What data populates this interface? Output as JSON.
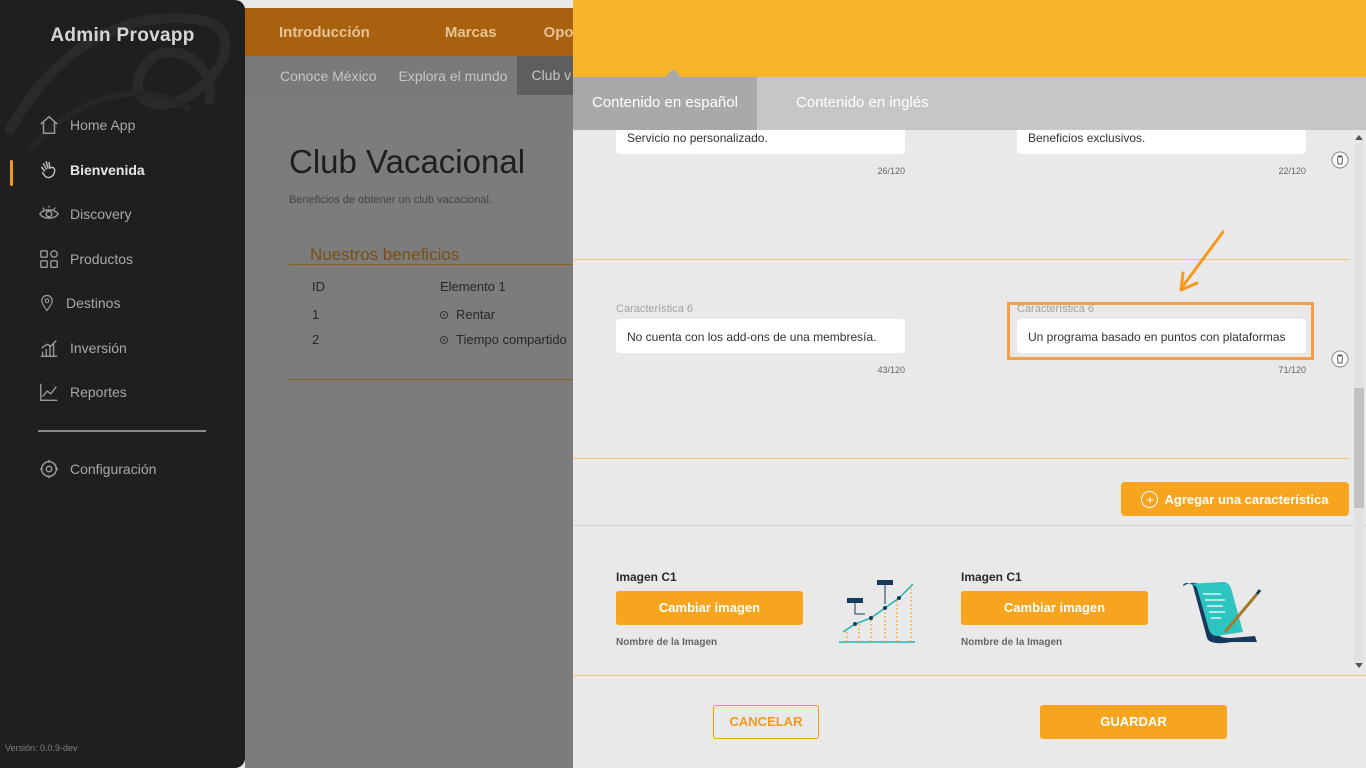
{
  "sidebar": {
    "brand": "Admin Provapp",
    "items": [
      {
        "label": "Home App",
        "icon": "home-icon"
      },
      {
        "label": "Bienvenida",
        "icon": "wave-hand-icon"
      },
      {
        "label": "Discovery",
        "icon": "eye-icon"
      },
      {
        "label": "Productos",
        "icon": "grid-icon"
      },
      {
        "label": "Destinos",
        "icon": "location-pin-icon"
      },
      {
        "label": "Inversión",
        "icon": "bar-chart-icon"
      },
      {
        "label": "Reportes",
        "icon": "line-chart-icon"
      }
    ],
    "config_label": "Configuración",
    "version": "Versión: 0.0.9-dev",
    "active_index": 1
  },
  "background": {
    "topnav": [
      "Introducción",
      "Marcas",
      "Oport"
    ],
    "subnav": [
      "Conoce México",
      "Explora el mundo",
      "Club v"
    ],
    "title": "Club Vacacional",
    "subtitle": "Beneficios de obtener un club vacacional.",
    "card_title": "Nuestros beneficios",
    "table": {
      "headers": [
        "ID",
        "Elemento 1"
      ],
      "rows": [
        {
          "id": "1",
          "value": "Rentar"
        },
        {
          "id": "2",
          "value": "Tiempo compartido"
        }
      ]
    }
  },
  "panel": {
    "tabs": {
      "spanish": "Contenido en español",
      "english": "Contenido en inglés"
    },
    "row5": {
      "left_value": "Servicio no personalizado.",
      "left_counter": "26/120",
      "right_value": "Beneficios exclusivos.",
      "right_counter": "22/120"
    },
    "row6": {
      "left_label": "Característica 6",
      "left_value": "No cuenta con los add-ons de una membresía.",
      "left_counter": "43/120",
      "right_label": "Característica 6",
      "right_value": "Un programa basado en puntos con plataformas",
      "right_counter": "71/120"
    },
    "add_label": "Agregar una característica",
    "images": {
      "left_label": "Imagen C1",
      "right_label": "Imagen C1",
      "change_label": "Cambiar imagen",
      "name_label": "Nombre de la Imagen"
    },
    "cancel_label": "CANCELAR",
    "save_label": "GUARDAR"
  },
  "colors": {
    "accent": "#f7a51f",
    "header": "#f7b52a",
    "sidebar": "#1f1f1f",
    "highlight": "#f4a04a"
  }
}
